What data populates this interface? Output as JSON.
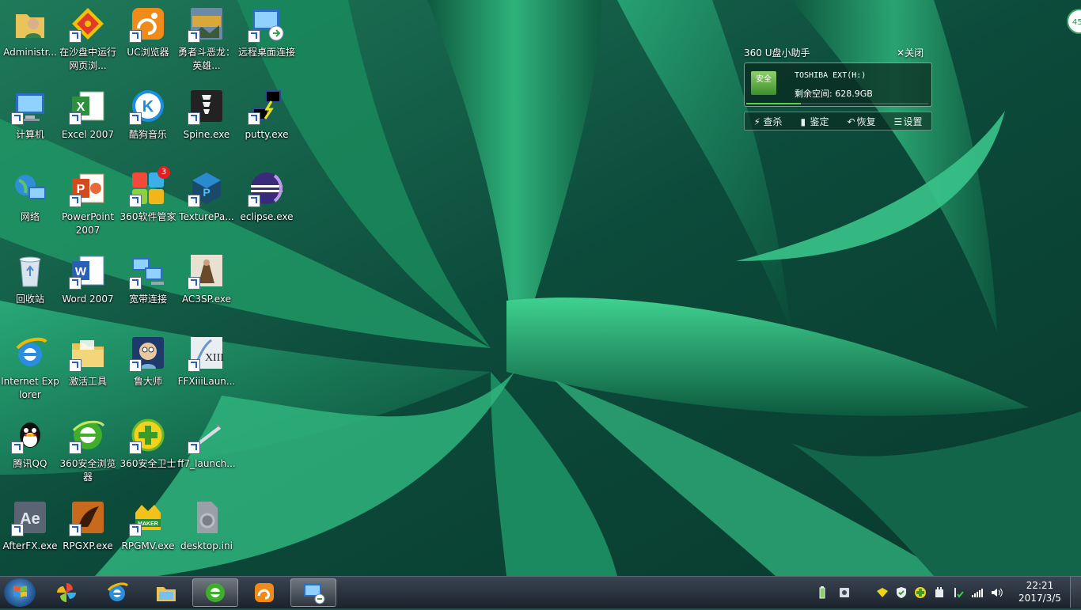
{
  "desktop": {
    "icons": [
      {
        "label": "Administr...",
        "icon": "user-folder-icon"
      },
      {
        "label": "在沙盘中运行网页浏...",
        "icon": "sandbox-icon"
      },
      {
        "label": "UC浏览器",
        "icon": "uc-browser-icon"
      },
      {
        "label": "勇者斗恶龙：英雄...",
        "icon": "game-icon"
      },
      {
        "label": "远程桌面连接",
        "icon": "remote-desktop-icon"
      },
      {
        "label": "计算机",
        "icon": "computer-icon"
      },
      {
        "label": "Excel 2007",
        "icon": "excel-icon"
      },
      {
        "label": "酷狗音乐",
        "icon": "kugou-icon"
      },
      {
        "label": "Spine.exe",
        "icon": "spine-icon"
      },
      {
        "label": "putty.exe",
        "icon": "putty-icon"
      },
      {
        "label": "网络",
        "icon": "network-icon"
      },
      {
        "label": "PowerPoint 2007",
        "icon": "powerpoint-icon"
      },
      {
        "label": "360软件管家",
        "icon": "360-software-icon"
      },
      {
        "label": "TexturePa...",
        "icon": "texturepacker-icon"
      },
      {
        "label": "eclipse.exe",
        "icon": "eclipse-icon"
      },
      {
        "label": "回收站",
        "icon": "recycle-bin-icon"
      },
      {
        "label": "Word 2007",
        "icon": "word-icon"
      },
      {
        "label": "宽带连接",
        "icon": "broadband-icon"
      },
      {
        "label": "AC3SP.exe",
        "icon": "ac3-icon"
      },
      {
        "label": "Internet Explorer",
        "icon": "ie-icon"
      },
      {
        "label": "激活工具",
        "icon": "folder-icon"
      },
      {
        "label": "鲁大师",
        "icon": "ludashi-icon"
      },
      {
        "label": "FFXiiiLaun...",
        "icon": "ffxiii-icon"
      },
      {
        "label": "腾讯QQ",
        "icon": "qq-icon"
      },
      {
        "label": "360安全浏览器",
        "icon": "360-browser-icon"
      },
      {
        "label": "360安全卫士",
        "icon": "360-safe-icon"
      },
      {
        "label": "ff7_launch...",
        "icon": "ff7-icon"
      },
      {
        "label": "AfterFX.exe",
        "icon": "after-effects-icon"
      },
      {
        "label": "RPGXP.exe",
        "icon": "rpgxp-icon"
      },
      {
        "label": "RPGMV.exe",
        "icon": "rpgmv-icon"
      },
      {
        "label": "desktop.ini",
        "icon": "settings-file-icon"
      }
    ],
    "badge_360": "3"
  },
  "usb_widget": {
    "title": "360 U盘小助手",
    "close_label": "关闭",
    "drive_tag": "安全",
    "drive_name": "TOSHIBA EXT(H:)",
    "free_space": "剩余空间: 628.9GB",
    "usage_fraction": 0.3,
    "actions": {
      "scan": "查杀",
      "identify": "鉴定",
      "restore": "恢复",
      "settings": "设置"
    }
  },
  "corner_badge": "45",
  "taskbar": {
    "clock_time": "22:21",
    "clock_date": "2017/3/5"
  }
}
